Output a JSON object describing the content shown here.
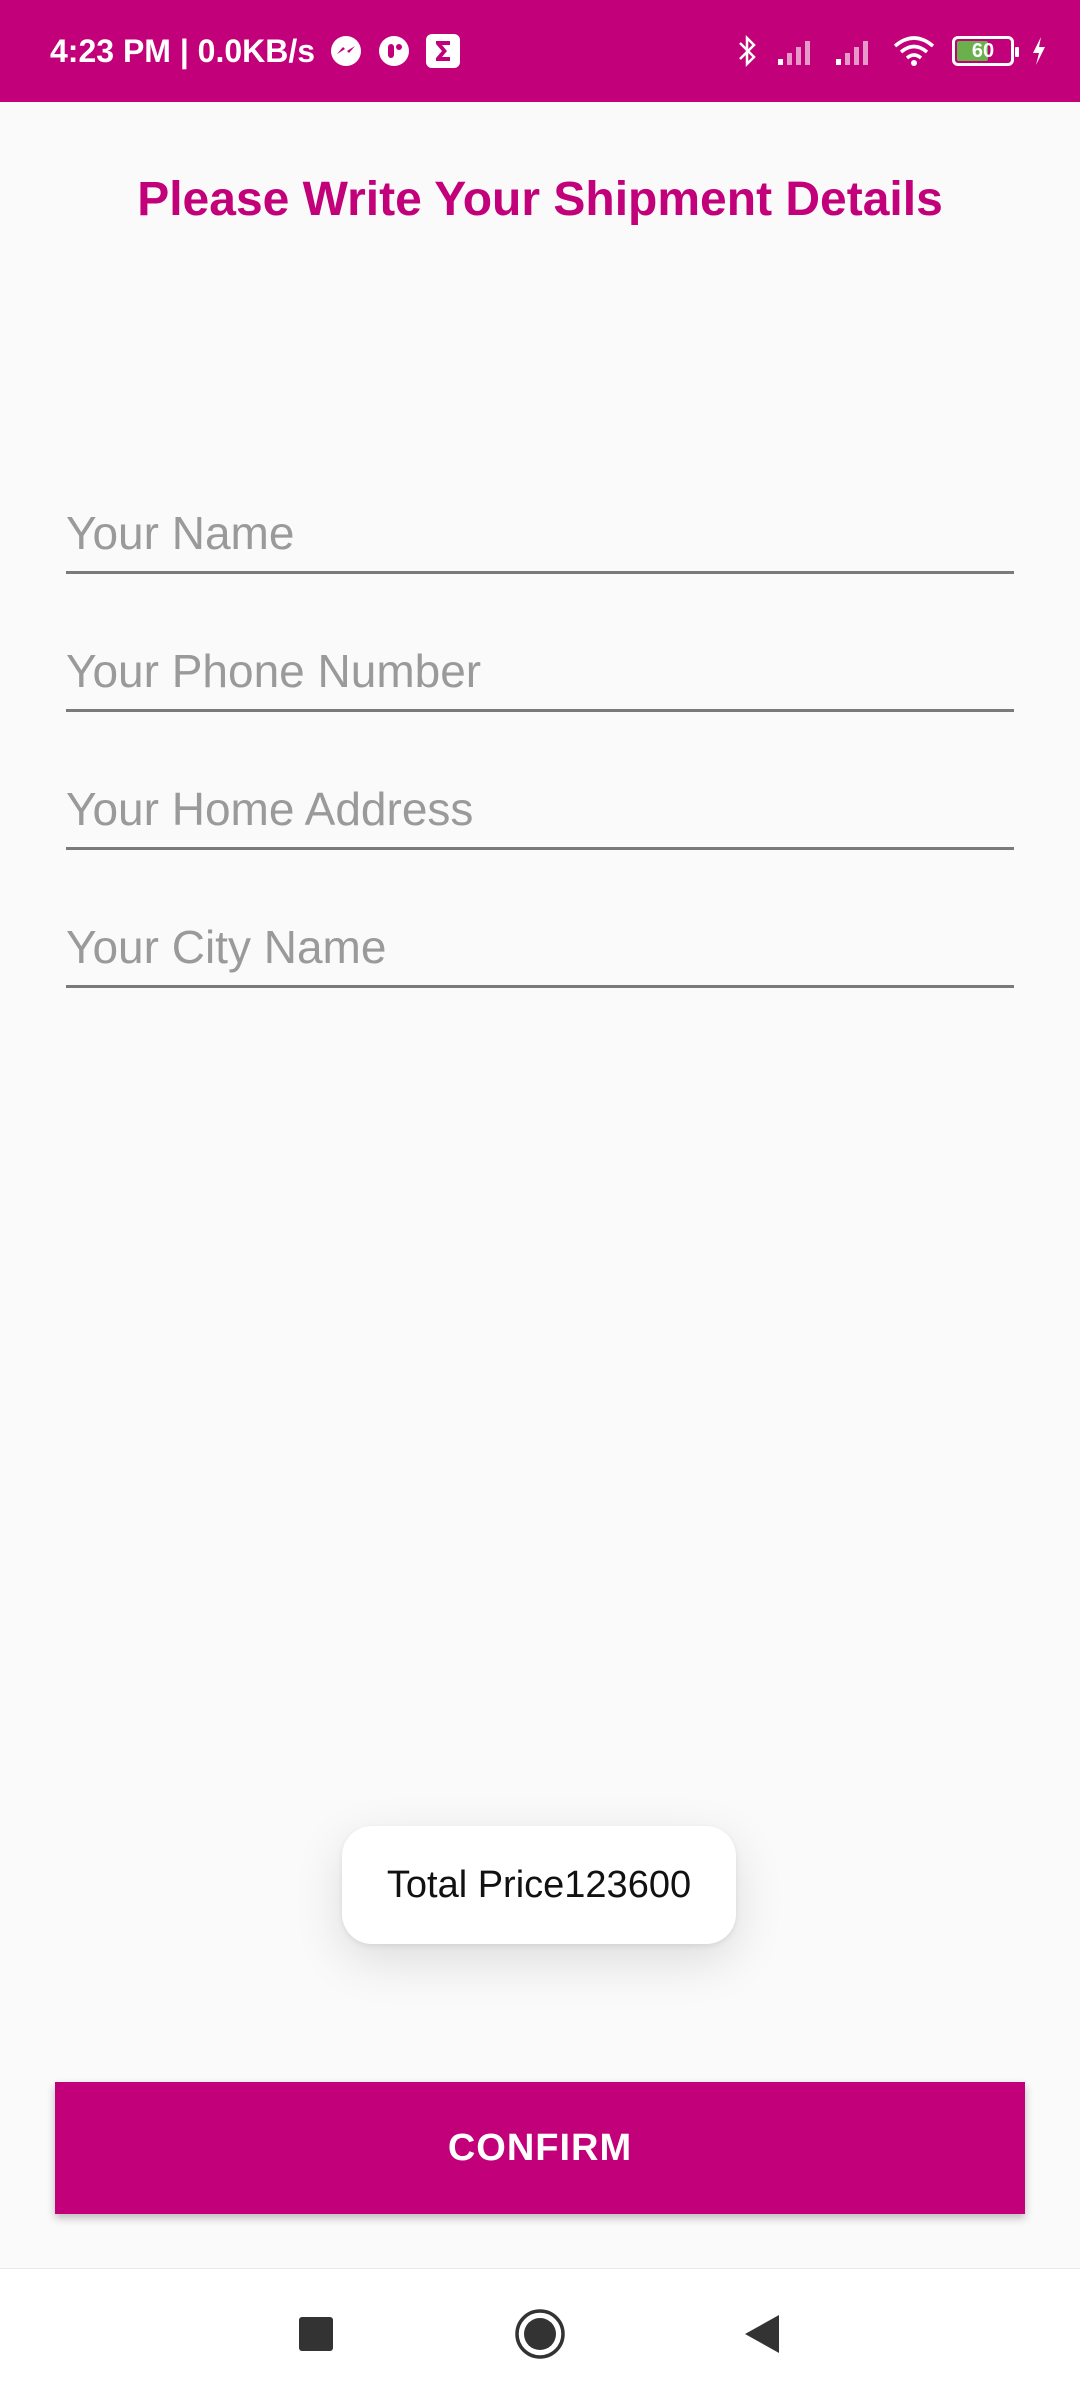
{
  "status_bar": {
    "time_speed": "4:23 PM | 0.0KB/s",
    "battery_level": "60",
    "icons": [
      "messenger-icon",
      "app-notification-icon",
      "sigma-icon",
      "bluetooth-icon",
      "signal-icon",
      "signal-icon",
      "wifi-icon",
      "battery-icon",
      "charging-icon"
    ]
  },
  "page": {
    "title": "Please Write Your Shipment Details"
  },
  "form": {
    "name_placeholder": "Your Name",
    "phone_placeholder": "Your Phone Number",
    "address_placeholder": "Your Home Address",
    "city_placeholder": "Your City Name"
  },
  "toast": {
    "text": "Total Price123600"
  },
  "actions": {
    "confirm_label": "CONFIRM"
  },
  "nav_bar": {
    "icons": [
      "recent-apps-icon",
      "home-icon",
      "back-icon"
    ]
  },
  "colors": {
    "accent": "#c2007a",
    "background": "#fafafa"
  }
}
